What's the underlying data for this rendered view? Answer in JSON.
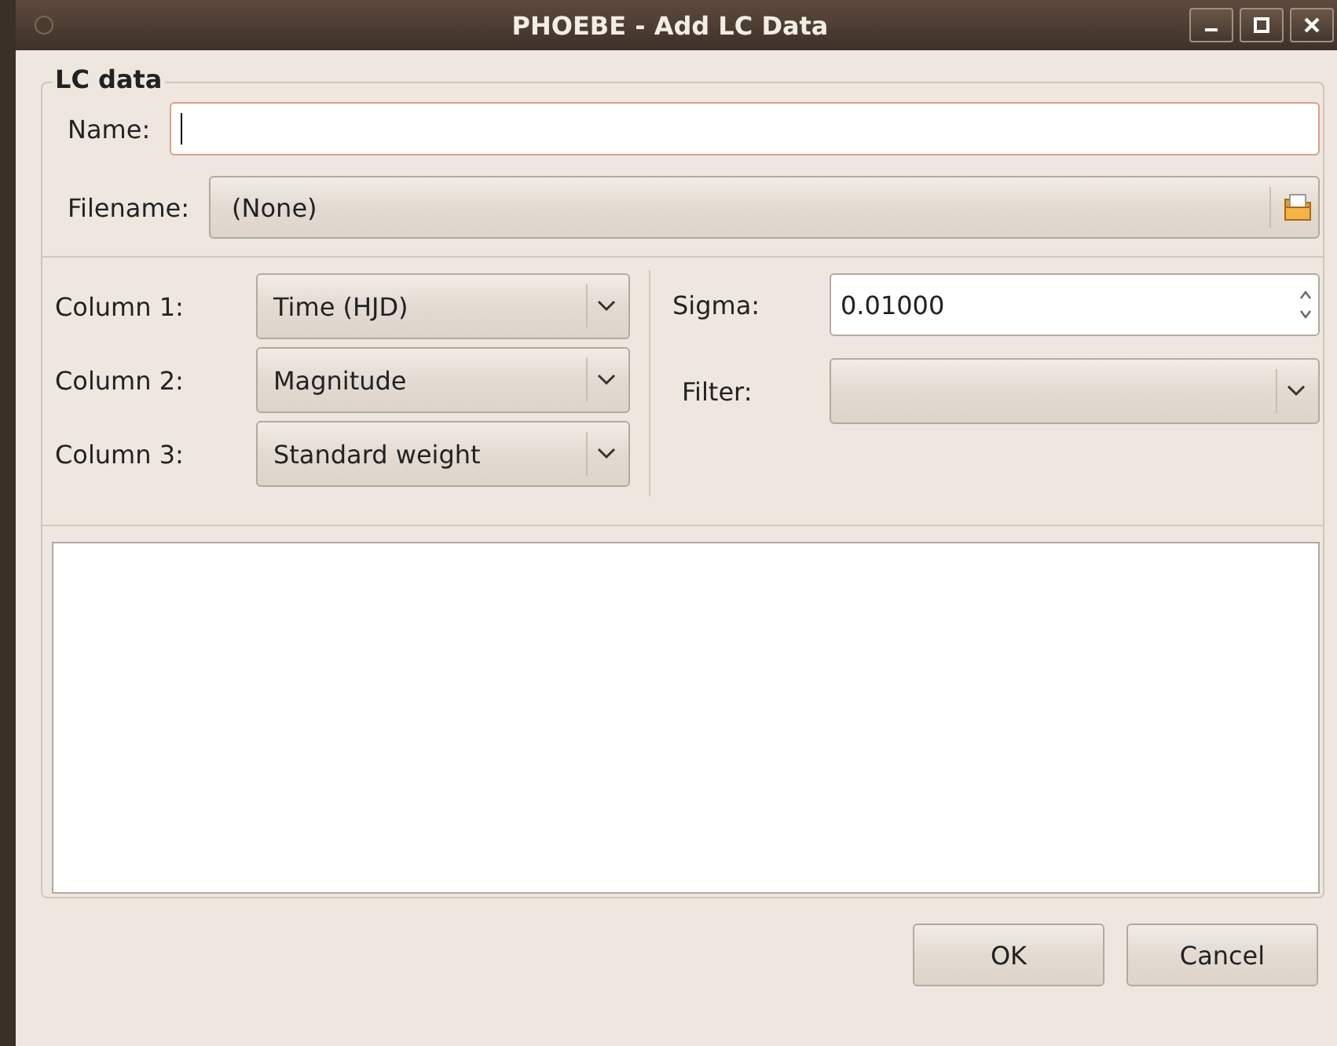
{
  "window": {
    "title": "PHOEBE - Add LC Data"
  },
  "frame": {
    "title": "LC data"
  },
  "name": {
    "label": "Name:"
  },
  "filename": {
    "label": "Filename:",
    "value": "(None)"
  },
  "columns": [
    {
      "label": "Column 1:",
      "value": "Time (HJD)"
    },
    {
      "label": "Column 2:",
      "value": "Magnitude"
    },
    {
      "label": "Column 3:",
      "value": "Standard weight"
    }
  ],
  "sigma": {
    "label": "Sigma:",
    "value": "0.01000"
  },
  "filter": {
    "label": "Filter:"
  },
  "buttons": [
    "OK",
    "Cancel"
  ]
}
